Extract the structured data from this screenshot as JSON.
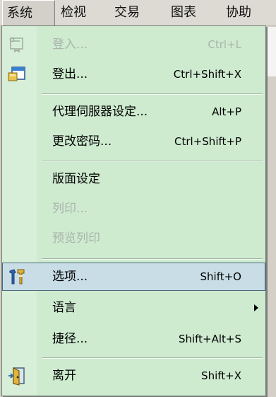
{
  "menubar": {
    "items": [
      "系统",
      "检视",
      "交易",
      "图表",
      "协助"
    ],
    "active_index": 0
  },
  "menu": {
    "items": [
      {
        "label": "登入...",
        "shortcut": "Ctrl+L",
        "disabled": true,
        "icon": "login-key-icon"
      },
      {
        "label": "登出...",
        "shortcut": "Ctrl+Shift+X",
        "disabled": false,
        "icon": "logout-icon"
      },
      {
        "label": "代理伺服器设定...",
        "shortcut": "Alt+P",
        "disabled": false
      },
      {
        "label": "更改密码...",
        "shortcut": "Ctrl+Shift+P",
        "disabled": false
      },
      {
        "label": "版面设定",
        "shortcut": "",
        "disabled": false
      },
      {
        "label": "列印...",
        "shortcut": "",
        "disabled": true
      },
      {
        "label": "预览列印",
        "shortcut": "",
        "disabled": true
      },
      {
        "label": "选项...",
        "shortcut": "Shift+O",
        "disabled": false,
        "selected": true,
        "icon": "options-tools-icon"
      },
      {
        "label": "语言",
        "shortcut": "",
        "disabled": false,
        "submenu": true
      },
      {
        "label": "捷径...",
        "shortcut": "Shift+Alt+S",
        "disabled": false
      },
      {
        "label": "离开",
        "shortcut": "Shift+X",
        "disabled": false,
        "icon": "exit-door-icon"
      }
    ]
  },
  "colors": {
    "menu_background": "#ceebd0",
    "selected_background": "#c8dde6",
    "disabled_text": "#a9b4aa"
  }
}
